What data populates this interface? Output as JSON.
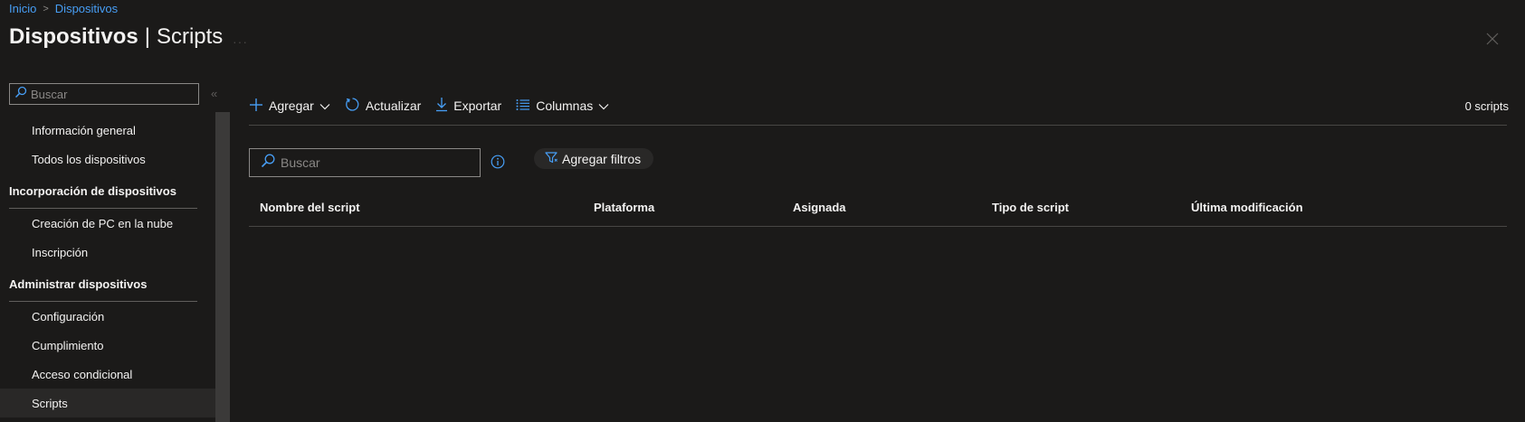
{
  "breadcrumb": {
    "home": "Inicio",
    "separator": ">",
    "current": "Dispositivos"
  },
  "title": {
    "main": "Dispositivos",
    "sub": "Scripts",
    "more": "···"
  },
  "sidebar": {
    "search_placeholder": "Buscar",
    "collapse": "«",
    "items": [
      {
        "label": "Información general",
        "type": "item"
      },
      {
        "label": "Todos los dispositivos",
        "type": "item"
      },
      {
        "label": "Incorporación de dispositivos",
        "type": "group"
      },
      {
        "label": "Creación de PC en la nube",
        "type": "item"
      },
      {
        "label": "Inscripción",
        "type": "item"
      },
      {
        "label": "Administrar dispositivos",
        "type": "group"
      },
      {
        "label": "Configuración",
        "type": "item"
      },
      {
        "label": "Cumplimiento",
        "type": "item"
      },
      {
        "label": "Acceso condicional",
        "type": "item"
      },
      {
        "label": "Scripts",
        "type": "item",
        "active": true
      }
    ]
  },
  "toolbar": {
    "add": "Agregar",
    "refresh": "Actualizar",
    "export": "Exportar",
    "columns": "Columnas",
    "count": "0 scripts"
  },
  "search": {
    "placeholder": "Buscar"
  },
  "filter": {
    "label": "Agregar filtros"
  },
  "table": {
    "columns": [
      "Nombre del script",
      "Plataforma",
      "Asignada",
      "Tipo de script",
      "Última modificación"
    ],
    "rows": []
  },
  "colors": {
    "accent": "#479ef5",
    "background": "#1b1a19",
    "text": "#f3f2f1"
  },
  "icons": {
    "add": "plus-icon",
    "refresh": "refresh-icon",
    "export": "download-icon",
    "columns": "list-icon",
    "search": "search-icon",
    "info": "info-icon",
    "filter": "filter-icon",
    "close": "close-icon"
  }
}
